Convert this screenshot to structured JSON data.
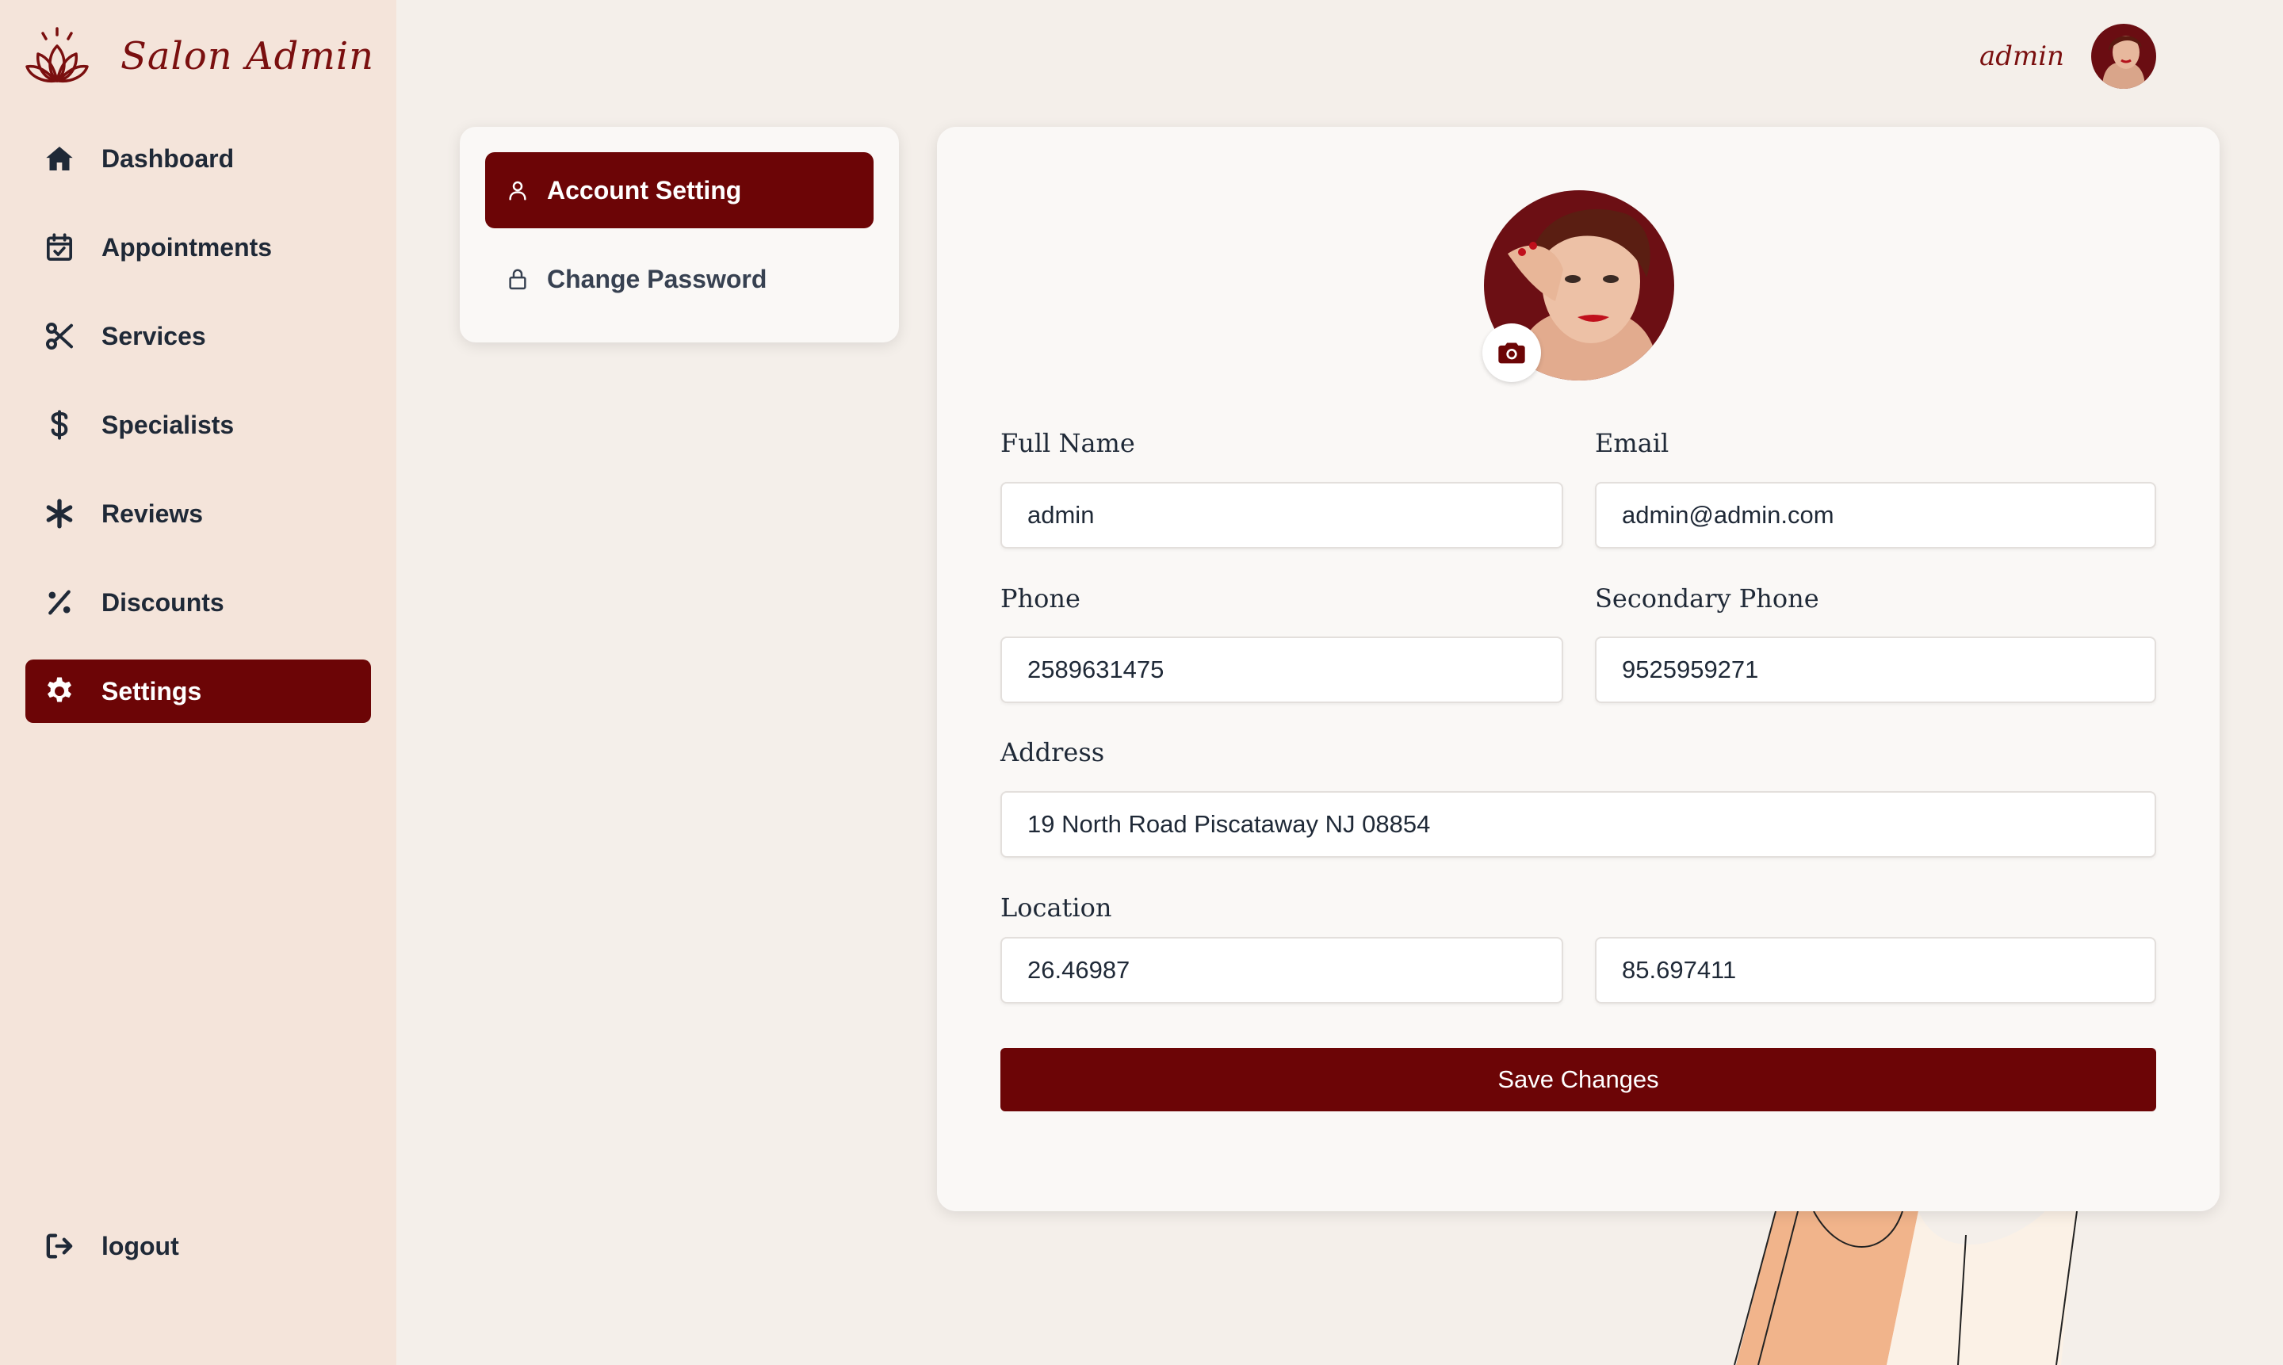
{
  "brand": {
    "name": "Salon Admin",
    "logo_icon": "lotus-icon"
  },
  "sidebar": {
    "items": [
      {
        "label": "Dashboard",
        "icon": "home-icon",
        "active": false
      },
      {
        "label": "Appointments",
        "icon": "calendar-check-icon",
        "active": false
      },
      {
        "label": "Services",
        "icon": "scissors-icon",
        "active": false
      },
      {
        "label": "Specialists",
        "icon": "specialist-icon",
        "active": false
      },
      {
        "label": "Reviews",
        "icon": "asterisk-icon",
        "active": false
      },
      {
        "label": "Discounts",
        "icon": "percent-icon",
        "active": false
      },
      {
        "label": "Settings",
        "icon": "gear-icon",
        "active": true
      }
    ],
    "logout": {
      "label": "logout",
      "icon": "logout-icon"
    }
  },
  "topbar": {
    "username": "admin"
  },
  "settings_menu": {
    "account": "Account Setting",
    "password": "Change Password"
  },
  "form": {
    "full_name": {
      "label": "Full Name",
      "value": "admin"
    },
    "email": {
      "label": "Email",
      "value": "admin@admin.com"
    },
    "phone": {
      "label": "Phone",
      "value": "2589631475"
    },
    "secondary_phone": {
      "label": "Secondary Phone",
      "value": "9525959271"
    },
    "address": {
      "label": "Address",
      "value": "19 North Road Piscataway NJ 08854"
    },
    "location": {
      "label": "Location",
      "latitude": "26.46987",
      "longitude": "85.697411"
    },
    "save_label": "Save Changes"
  },
  "colors": {
    "accent": "#6c0506",
    "sidebar_bg": "#f4e4da",
    "page_bg": "#f4efea",
    "card_bg": "#faf8f6"
  }
}
